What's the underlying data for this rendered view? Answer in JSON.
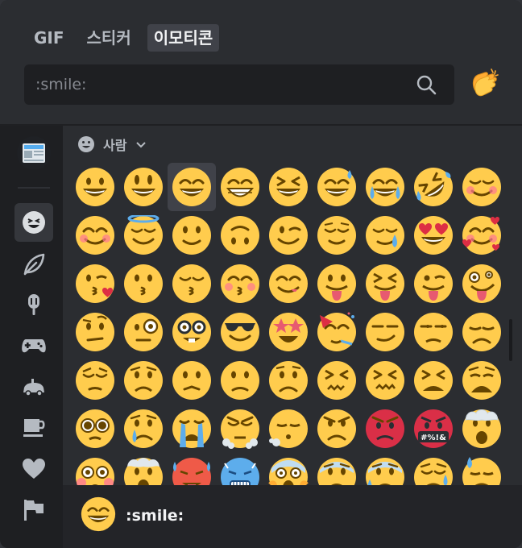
{
  "tabs": [
    {
      "label": "GIF",
      "active": false
    },
    {
      "label": "스티커",
      "active": false
    },
    {
      "label": "이모티콘",
      "active": true
    }
  ],
  "search": {
    "placeholder": ":smile:",
    "icon": "search-icon"
  },
  "random_emoji_icon": "clapping-hands-icon",
  "sidebar": [
    {
      "name": "newspaper",
      "icon": "newspaper-icon",
      "active": false
    },
    {
      "name": "people",
      "icon": "smiley-icon",
      "active": true
    },
    {
      "name": "nature",
      "icon": "leaf-icon",
      "active": false
    },
    {
      "name": "food",
      "icon": "popsicle-icon",
      "active": false
    },
    {
      "name": "activities",
      "icon": "gamepad-icon",
      "active": false
    },
    {
      "name": "travel",
      "icon": "car-icon",
      "active": false
    },
    {
      "name": "objects",
      "icon": "cup-icon",
      "active": false
    },
    {
      "name": "symbols",
      "icon": "heart-icon",
      "active": false
    },
    {
      "name": "flags",
      "icon": "flag-icon",
      "active": false
    }
  ],
  "category": {
    "label": "사람",
    "icon": "smiley-icon",
    "chevron": "chevron-down-icon"
  },
  "emoji_rows": [
    [
      "grinning",
      "smiley",
      "smile",
      "grin",
      "laughing",
      "sweat-smile",
      "joy",
      "rofl",
      "blush"
    ],
    [
      "blush-happy",
      "innocent",
      "slight-smile",
      "upside-down",
      "wink",
      "relieved",
      "sweat",
      "heart-eyes",
      "smiling-hearts"
    ],
    [
      "kissing-heart",
      "kissing",
      "kissing-closed-eyes",
      "kissing-smiling-eyes",
      "yum",
      "tongue",
      "squint-tongue",
      "tongue-wink",
      "zany"
    ],
    [
      "raised-eyebrow",
      "monocle",
      "nerd",
      "sunglasses",
      "star-struck",
      "partying",
      "smirk",
      "unamused",
      "disappointed"
    ],
    [
      "pensive",
      "worried",
      "confused",
      "slight-frown",
      "frowning",
      "persevere",
      "confounded",
      "tired",
      "weary"
    ],
    [
      "pleading",
      "cry",
      "sob",
      "triumph",
      "exhale",
      "angry",
      "rage",
      "cursing",
      "exploding-head"
    ],
    [
      "flushed",
      "hot-cold",
      "hot",
      "cold",
      "scream",
      "fearful",
      "cold-sweat",
      "disappointed-relieved",
      "downcast-sweat"
    ]
  ],
  "hovered_emoji": "smile",
  "curse_text": "#%!&",
  "footer": {
    "emoji_icon": "smile-icon",
    "name": ":smile:"
  },
  "colors": {
    "emoji_yellow": "#ffcc4d",
    "feature": "#664500",
    "accent_blue": "#5dadec",
    "heart_red": "#dd2e44"
  }
}
